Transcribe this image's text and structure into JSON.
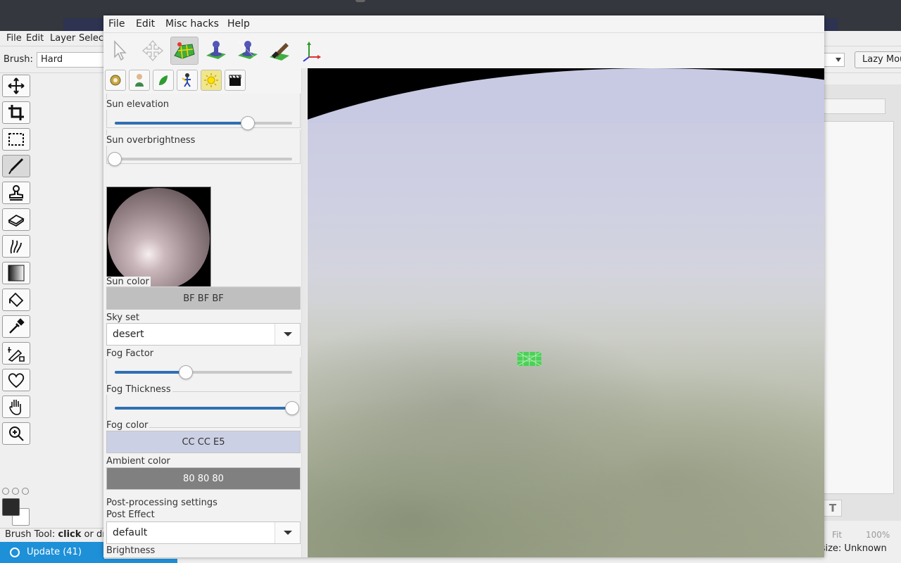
{
  "background_app": {
    "menu": [
      "File",
      "Edit",
      "Layer",
      "Selec"
    ],
    "brush_label": "Brush:",
    "brush_value": "Hard",
    "lazy_button": "Lazy Mou",
    "status_text_prefix": "Brush Tool:",
    "status_text_bold": "click",
    "status_text_suffix": "or dr",
    "size_text": "al size: Unknown",
    "fit_label": "Fit",
    "zoom_label": "100%",
    "update_label": "Update (41)",
    "tools": [
      "move-icon",
      "crop-icon",
      "rect-select-icon",
      "brush-icon",
      "stamp-icon",
      "eraser-icon",
      "smudge-icon",
      "gradient-icon",
      "fill-icon",
      "eyedropper-icon",
      "pen-icon",
      "heart-shape-icon",
      "hand-icon",
      "zoom-icon"
    ]
  },
  "window": {
    "menu": [
      "File",
      "Edit",
      "Misc hacks",
      "Help"
    ],
    "toolbar_icons": [
      "select-arrow-icon",
      "move-cross-icon",
      "terrain-grid-icon",
      "object-icon",
      "object-2-icon",
      "brush-paint-icon",
      "axes-icon"
    ],
    "subtabs": [
      "settings-icon",
      "character-icon",
      "plant-icon",
      "figure-icon",
      "sun-icon",
      "clapper-icon"
    ]
  },
  "panel": {
    "sun_elevation": {
      "label": "Sun elevation",
      "value": 0.75
    },
    "sun_overbrightness": {
      "label": "Sun overbrightness",
      "value": 0.0
    },
    "sun_color": {
      "label": "Sun color",
      "value": "BF BF BF",
      "hex": "#bfbfbf"
    },
    "sky_set": {
      "label": "Sky set",
      "value": "desert"
    },
    "fog_factor": {
      "label": "Fog Factor",
      "value": 0.4
    },
    "fog_thickness": {
      "label": "Fog Thickness",
      "value": 1.0
    },
    "fog_color": {
      "label": "Fog color",
      "value": "CC CC E5",
      "hex": "#ccd0e5"
    },
    "ambient_color": {
      "label": "Ambient color",
      "value": "80 80 80",
      "hex": "#808080"
    },
    "post_processing": {
      "label": "Post-processing settings"
    },
    "post_effect": {
      "label": "Post Effect",
      "value": "default"
    },
    "brightness": {
      "label": "Brightness"
    }
  },
  "colors": {
    "accent": "#2f6fb5",
    "update_bar": "#1e90d8",
    "marker": "#3bd14a"
  }
}
